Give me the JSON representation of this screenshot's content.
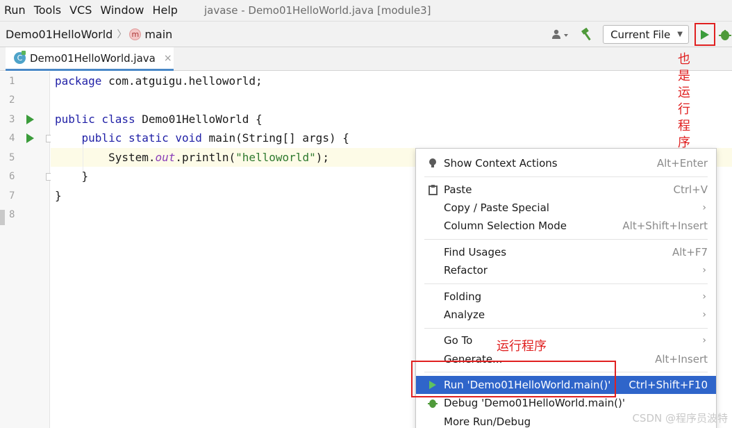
{
  "menubar": {
    "items": [
      {
        "label": "Run"
      },
      {
        "label": "Tools"
      },
      {
        "label": "VCS"
      },
      {
        "label": "Window"
      },
      {
        "label": "Help"
      }
    ],
    "window_title": "javase - Demo01HelloWorld.java [module3]"
  },
  "navbar": {
    "class_crumb": "Demo01HelloWorld",
    "method_crumb": "main",
    "run_config": "Current File"
  },
  "tab": {
    "label": "Demo01HelloWorld.java",
    "close": "×"
  },
  "editor": {
    "line_numbers": [
      "1",
      "2",
      "3",
      "4",
      "5",
      "6",
      "7",
      "8"
    ],
    "lines": [
      {
        "kw1": "package",
        "rest": " com.atguigu.helloworld;"
      },
      {
        "text": ""
      },
      {
        "kw1": "public class",
        "rest": " Demo01HelloWorld {"
      },
      {
        "indent": "    ",
        "kw1": "public static void",
        "rest": " main(String[] args) {"
      },
      {
        "pre": "        System.",
        "field": "out",
        "mid": ".println(",
        "str": "\"helloworld\"",
        "post": ");"
      },
      {
        "text": "    }"
      },
      {
        "text": "}"
      },
      {
        "text": ""
      }
    ]
  },
  "annotations": {
    "top": "也是运行程序",
    "menu": "运行程序"
  },
  "context_menu": {
    "items": [
      {
        "label": "Show Context Actions",
        "shortcut": "Alt+Enter"
      },
      {
        "label": "Paste",
        "shortcut": "Ctrl+V"
      },
      {
        "label": "Copy / Paste Special",
        "submenu": "›"
      },
      {
        "label": "Column Selection Mode",
        "shortcut": "Alt+Shift+Insert"
      },
      {
        "label": "Find Usages",
        "shortcut": "Alt+F7"
      },
      {
        "label": "Refactor",
        "submenu": "›"
      },
      {
        "label": "Folding",
        "submenu": "›"
      },
      {
        "label": "Analyze",
        "submenu": "›"
      },
      {
        "label": "Go To",
        "submenu": "›"
      },
      {
        "label": "Generate...",
        "shortcut": "Alt+Insert"
      },
      {
        "label": "Run 'Demo01HelloWorld.main()'",
        "shortcut": "Ctrl+Shift+F10"
      },
      {
        "label": "Debug 'Demo01HelloWorld.main()'"
      },
      {
        "label": "More Run/Debug"
      }
    ]
  },
  "watermark": "CSDN @程序员波特",
  "icons": {
    "bulb": "bulb-icon",
    "paste": "clipboard-icon",
    "run": "run-icon",
    "debug": "bug-icon"
  },
  "colors": {
    "accent": "#2f65ca",
    "run_green": "#3b9c3b",
    "annotation_red": "#e02020"
  }
}
